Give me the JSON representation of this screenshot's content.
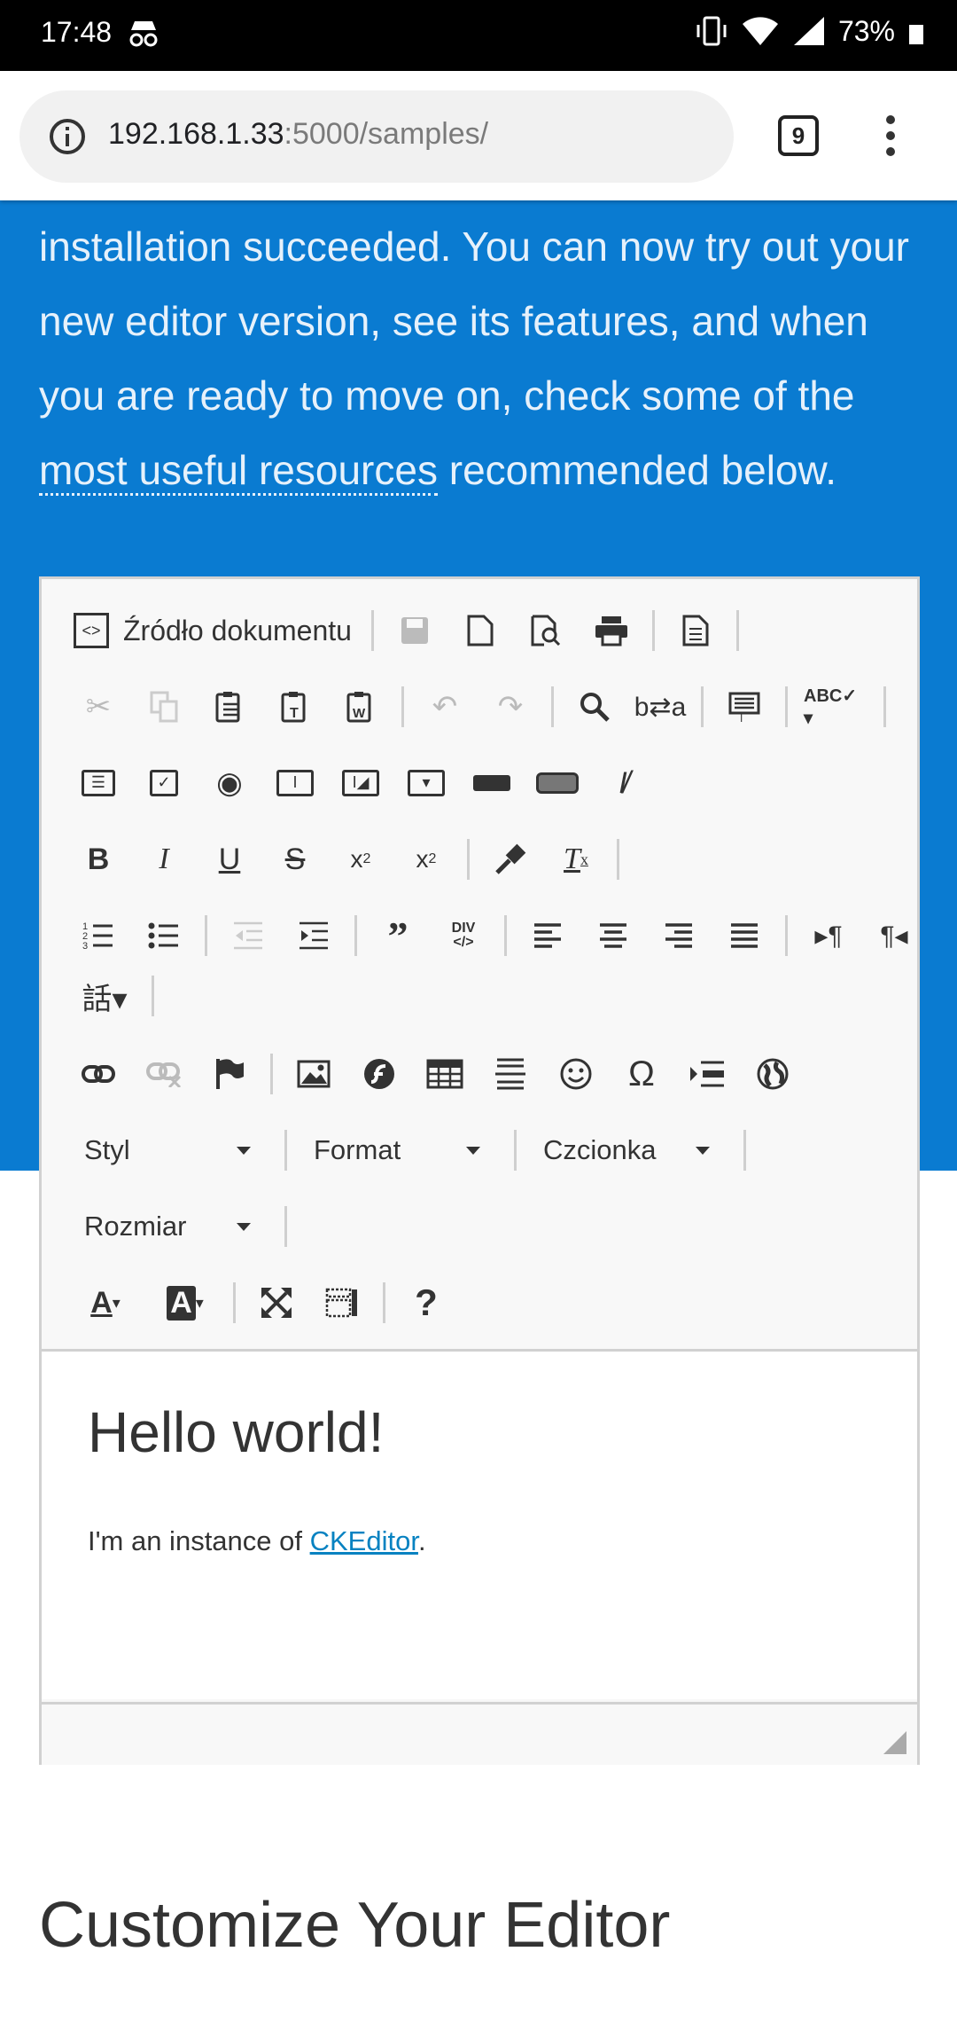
{
  "status": {
    "time": "17:48",
    "battery": "73%"
  },
  "browser": {
    "url_host": "192.168.1.33",
    "url_path": ":5000/samples/",
    "tab_count": "9"
  },
  "hero": {
    "text_before": "installation succeeded. You can now try out your new editor version, see its features, and when you are ready to move on, check some of the ",
    "link": "most useful resources",
    "text_after": " recommended below."
  },
  "toolbar": {
    "source_label": "Źródło dokumentu",
    "styles_label": "Styl",
    "format_label": "Format",
    "font_label": "Czcionka",
    "size_label": "Rozmiar"
  },
  "editor": {
    "heading": "Hello world!",
    "para_before": "I'm an instance of ",
    "para_link": "CKEditor",
    "para_after": "."
  },
  "section": {
    "title": "Customize Your Editor"
  }
}
